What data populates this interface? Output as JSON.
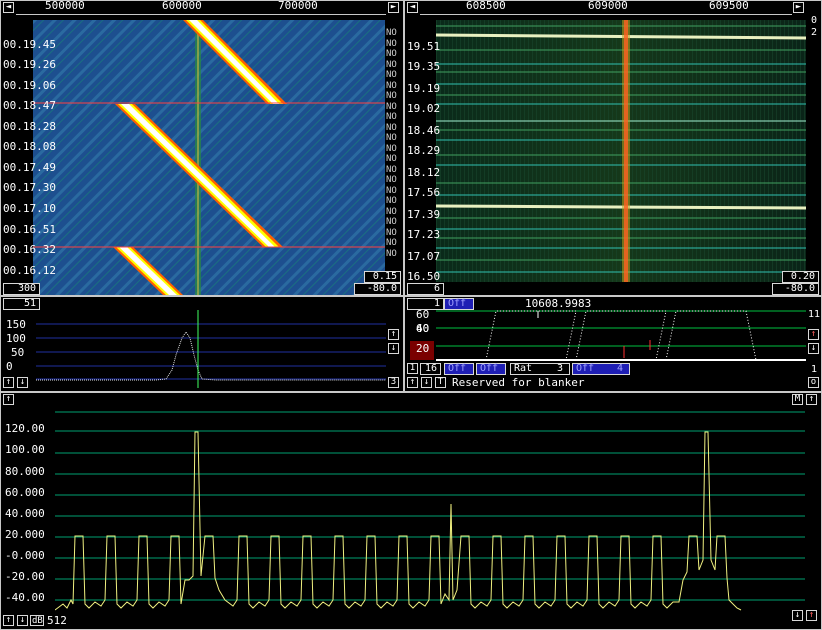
{
  "left_panel": {
    "freq_labels": [
      "500000",
      "600000",
      "700000"
    ],
    "time_labels": [
      "00.19.45",
      "00.19.26",
      "00.19.06",
      "00.18.47",
      "00.18.28",
      "00.18.08",
      "00.17.49",
      "00.17.30",
      "00.17.10",
      "00.16.51",
      "00.16.32",
      "00.16.12"
    ],
    "no_marker": "NO",
    "gain_value": "0.15",
    "zero_value": "-80.0",
    "avg_value": "300"
  },
  "right_panel": {
    "freq_labels": [
      "608500",
      "609000",
      "609500"
    ],
    "corner_top": "0",
    "corner_bottom": "2",
    "time_labels": [
      "19.51",
      "19.35",
      "19.19",
      "19.02",
      "18.46",
      "18.29",
      "18.12",
      "17.56",
      "17.39",
      "17.23",
      "17.07",
      "16.50"
    ],
    "gain_value": "0.20",
    "zero_value": "-80.0",
    "avg_value": "6"
  },
  "spectrum_small": {
    "level_box": "51",
    "y_labels": [
      "150",
      "100",
      "50",
      "0"
    ],
    "right_value": "3"
  },
  "control_panel": {
    "box1": "1",
    "off1": "Off",
    "frequency": "10608.9983",
    "y_labels": [
      "60",
      "40",
      "20"
    ],
    "right_top": "11",
    "box16": "16",
    "off2": "Off",
    "off3": "Off",
    "rat_label": "Rat",
    "rat_value": "3",
    "off4": "Off",
    "off4_value": "4",
    "status": "Reserved for blanker",
    "right_bottom": "1",
    "o_button": "o",
    "t_button": "T"
  },
  "main_spectrum": {
    "y_labels": [
      "120.00",
      "100.00",
      "80.000",
      "60.000",
      "40.000",
      "20.000",
      "-0.000",
      "-20.00",
      "-40.00"
    ],
    "db_label": "dB",
    "width_value": "512",
    "m_button": "M"
  },
  "colors": {
    "waterfall_bg": "#1a4a8a",
    "trace": "#f0f080",
    "grid_green": "#00a070",
    "grid_blue": "#2030a0"
  }
}
